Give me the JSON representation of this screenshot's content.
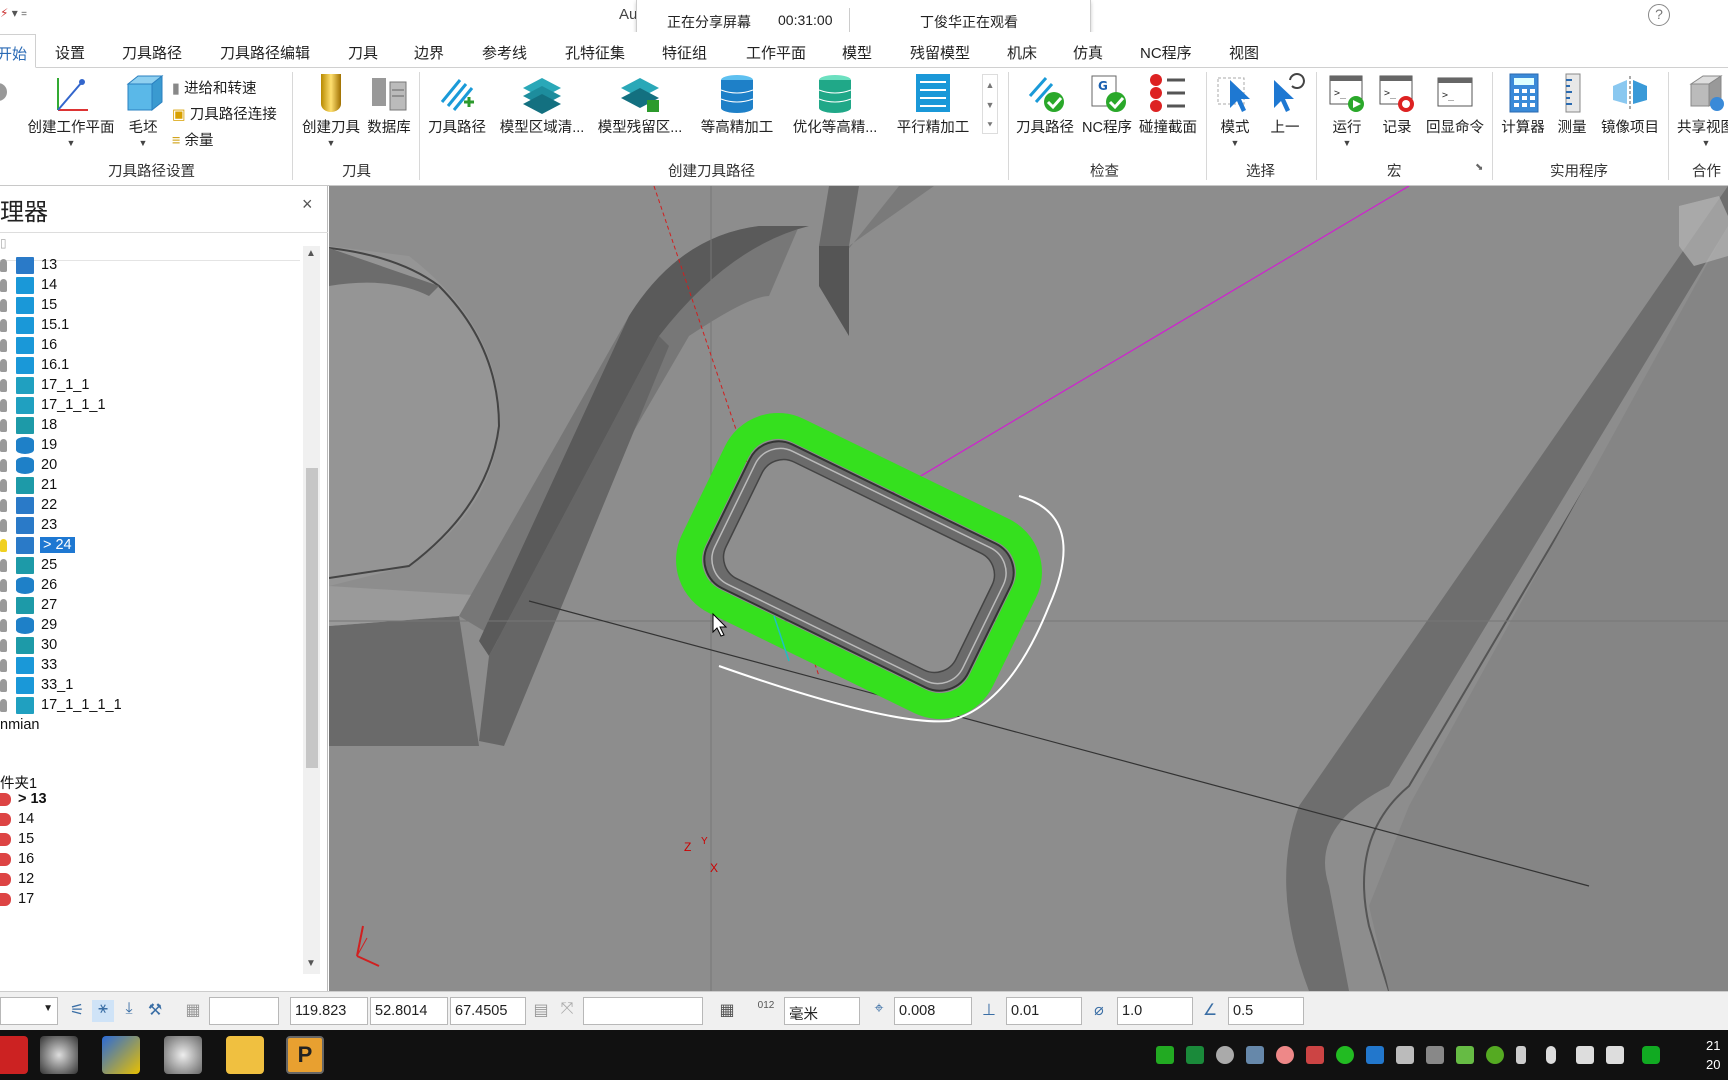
{
  "title_bar": {
    "app_title": "Au",
    "share_status": "正在分享屏幕",
    "share_time": "00:31:00",
    "viewer_status": "丁俊华正在观看",
    "help": "?"
  },
  "menu_tabs": [
    "开始",
    "设置",
    "刀具路径",
    "刀具路径编辑",
    "刀具",
    "边界",
    "参考线",
    "孔特征集",
    "特征组",
    "工作平面",
    "模型",
    "残留模型",
    "机床",
    "仿真",
    "NC程序",
    "视图"
  ],
  "ribbon": {
    "setup_group": {
      "label": "刀具路径设置",
      "create_workplane": "创建工作平面",
      "stock": "毛坯",
      "leads_links": "进给和转速",
      "toolpath_connect": "刀具路径连接",
      "allowance": "余量"
    },
    "tool_group": {
      "label": "刀具",
      "create_tool": "创建刀具",
      "database": "数据库"
    },
    "create_toolpath_group": {
      "label": "创建刀具路径",
      "items": [
        "刀具路径",
        "模型区域清...",
        "模型残留区...",
        "等高精加工",
        "优化等高精...",
        "平行精加工"
      ]
    },
    "check_group": {
      "label": "检查",
      "items": [
        "刀具路径",
        "NC程序",
        "碰撞截面"
      ]
    },
    "select_group": {
      "label": "选择",
      "items": [
        "模式",
        "上一"
      ]
    },
    "macro_group": {
      "label": "宏",
      "items": [
        "运行",
        "记录",
        "回显命令"
      ]
    },
    "utilities_group": {
      "label": "实用程序",
      "items": [
        "计算器",
        "测量",
        "镜像项目"
      ]
    },
    "collab_group": {
      "label": "合作",
      "items": [
        "共享视图"
      ]
    }
  },
  "explorer": {
    "title": "理器",
    "close": "×",
    "toolpaths": [
      {
        "label": "13",
        "icon": "toolpath-area"
      },
      {
        "label": "14",
        "icon": "toolpath-raster"
      },
      {
        "label": "15",
        "icon": "toolpath-raster"
      },
      {
        "label": "15.1",
        "icon": "toolpath-raster"
      },
      {
        "label": "16",
        "icon": "toolpath-raster"
      },
      {
        "label": "16.1",
        "icon": "toolpath-raster"
      },
      {
        "label": "17_1_1",
        "icon": "toolpath-drill"
      },
      {
        "label": "17_1_1_1",
        "icon": "toolpath-drill"
      },
      {
        "label": "18",
        "icon": "toolpath-layers"
      },
      {
        "label": "19",
        "icon": "toolpath-stack"
      },
      {
        "label": "20",
        "icon": "toolpath-stack"
      },
      {
        "label": "21",
        "icon": "toolpath-layers"
      },
      {
        "label": "22",
        "icon": "toolpath-area"
      },
      {
        "label": "23",
        "icon": "toolpath-area"
      },
      {
        "label": "> 24",
        "icon": "toolpath-area",
        "selected": true
      },
      {
        "label": "25",
        "icon": "toolpath-layers"
      },
      {
        "label": "26",
        "icon": "toolpath-stack"
      },
      {
        "label": "27",
        "icon": "toolpath-layers"
      },
      {
        "label": "29",
        "icon": "toolpath-stack"
      },
      {
        "label": "30",
        "icon": "toolpath-layers"
      },
      {
        "label": "33",
        "icon": "toolpath-raster"
      },
      {
        "label": "33_1",
        "icon": "toolpath-raster"
      },
      {
        "label": "17_1_1_1_1",
        "icon": "toolpath-drill"
      }
    ],
    "folder_name": "nmian",
    "folder2": "件夹1",
    "tools": [
      {
        "label": "> 13",
        "bold": true
      },
      {
        "label": "14"
      },
      {
        "label": "15"
      },
      {
        "label": "16"
      },
      {
        "label": "12"
      },
      {
        "label": "17"
      }
    ]
  },
  "viewport": {
    "axis_z": "Z",
    "axis_x": "X",
    "axis_y": "Y"
  },
  "status_bar": {
    "coord_x": "119.823",
    "coord_y": "52.8014",
    "coord_z": "67.4505",
    "units": "毫米",
    "tolerance": "0.008",
    "stepover": "0.01",
    "diameter": "1.0",
    "angle": "0.5"
  },
  "clock": {
    "line1": "21",
    "line2": "20"
  },
  "colors": {
    "accent": "#1e78d2",
    "toolpath_green": "#35e01e",
    "magenta_line": "#d020d0",
    "viewport_bg": "#8c8c8c"
  }
}
